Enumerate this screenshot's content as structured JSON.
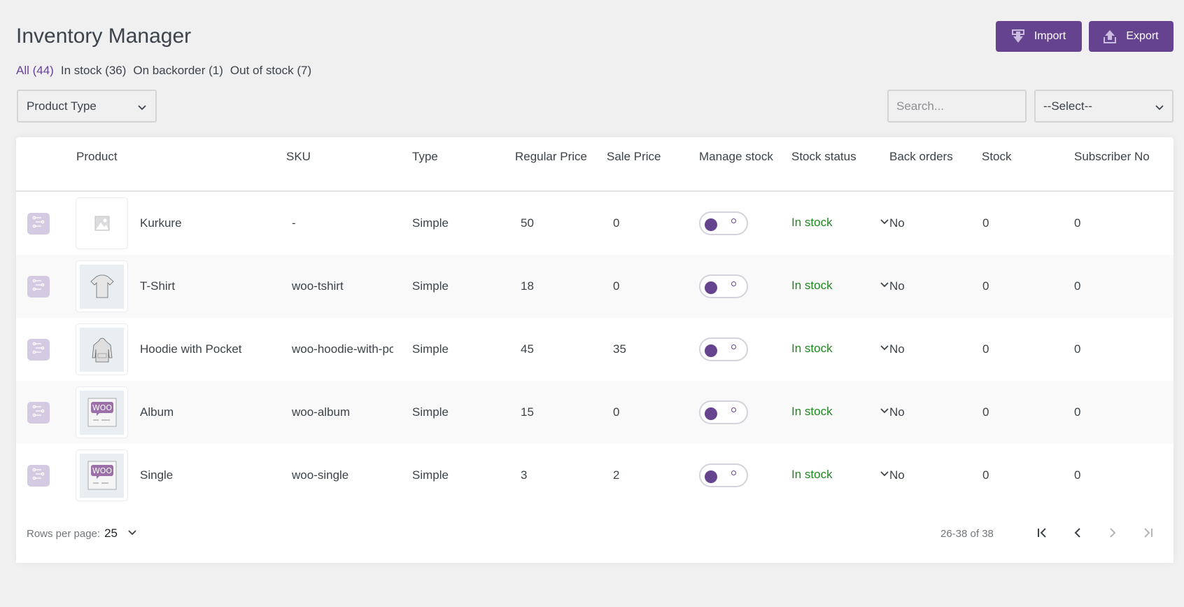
{
  "header": {
    "title": "Inventory Manager",
    "import_label": "Import",
    "export_label": "Export"
  },
  "filters": [
    {
      "label": "All (44)",
      "active": true
    },
    {
      "label": "In stock (36)",
      "active": false
    },
    {
      "label": "On backorder (1)",
      "active": false
    },
    {
      "label": "Out of stock (7)",
      "active": false
    }
  ],
  "toolbar": {
    "product_type_value": "Product Type",
    "search_placeholder": "Search...",
    "search_value": "",
    "select_value": "--Select--"
  },
  "table": {
    "columns": [
      "Product",
      "SKU",
      "Type",
      "Regular Price",
      "Sale Price",
      "Manage stock",
      "Stock status",
      "Back orders",
      "Stock",
      "Subscriber No"
    ],
    "rows": [
      {
        "product": "Kurkure",
        "image": "placeholder-image-icon",
        "sku": "-",
        "type": "Simple",
        "regular_price": "50",
        "sale_price": "0",
        "manage_stock": true,
        "stock_status": "In stock",
        "back_orders": "No",
        "stock": "0",
        "subscriber_no": "0"
      },
      {
        "product": "T-Shirt",
        "image": "tshirt-image",
        "sku": "woo-tshirt",
        "type": "Simple",
        "regular_price": "18",
        "sale_price": "0",
        "manage_stock": true,
        "stock_status": "In stock",
        "back_orders": "No",
        "stock": "0",
        "subscriber_no": "0"
      },
      {
        "product": "Hoodie with Pocket",
        "image": "hoodie-image",
        "sku": "woo-hoodie-with-pocket",
        "type": "Simple",
        "regular_price": "45",
        "sale_price": "35",
        "manage_stock": true,
        "stock_status": "In stock",
        "back_orders": "No",
        "stock": "0",
        "subscriber_no": "0"
      },
      {
        "product": "Album",
        "image": "woo-album-image",
        "sku": "woo-album",
        "type": "Simple",
        "regular_price": "15",
        "sale_price": "0",
        "manage_stock": true,
        "stock_status": "In stock",
        "back_orders": "No",
        "stock": "0",
        "subscriber_no": "0"
      },
      {
        "product": "Single",
        "image": "woo-single-image",
        "sku": "woo-single",
        "type": "Simple",
        "regular_price": "3",
        "sale_price": "2",
        "manage_stock": true,
        "stock_status": "In stock",
        "back_orders": "No",
        "stock": "0",
        "subscriber_no": "0"
      }
    ]
  },
  "pagination": {
    "rows_per_page_label": "Rows per page:",
    "rows_per_page_value": "25",
    "range_text": "26-38 of 38"
  },
  "colors": {
    "accent": "#66438f",
    "in_stock": "#1e8a1e",
    "background": "#f0f0f1"
  }
}
